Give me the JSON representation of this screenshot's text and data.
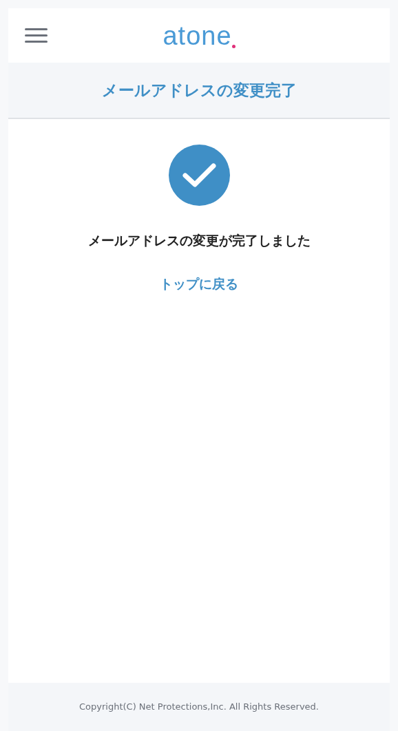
{
  "header": {
    "logo": "atone"
  },
  "page_title": "メールアドレスの変更完了",
  "message": "メールアドレスの変更が完了しました",
  "back_link": "トップに戻る",
  "footer": "Copyright(C) Net Protections,Inc. All Rights Reserved."
}
